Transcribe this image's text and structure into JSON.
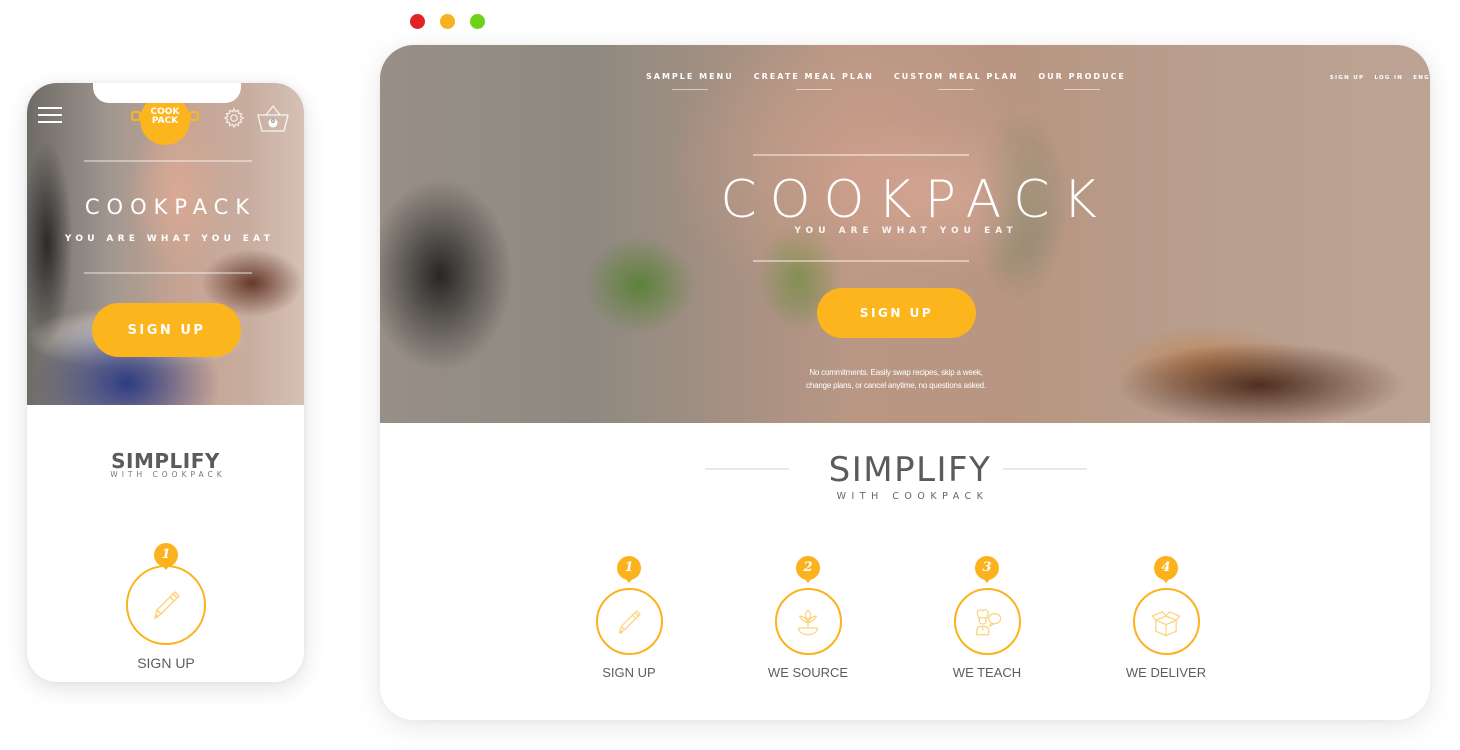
{
  "window": {
    "controls": [
      "close",
      "minimize",
      "maximize"
    ],
    "colors": {
      "close": "#e02424",
      "minimize": "#f7b21f",
      "maximize": "#6fd118"
    }
  },
  "brand": {
    "accent": "#fdb51e",
    "text_dark": "#5b5b5b"
  },
  "desktop": {
    "nav": {
      "items": [
        {
          "label": "SAMPLE MENU"
        },
        {
          "label": "CREATE MEAL PLAN"
        },
        {
          "label": "CUSTOM MEAL PLAN"
        },
        {
          "label": "OUR PRODUCE"
        }
      ]
    },
    "utility_nav": {
      "sign_up": "SIGN UP",
      "log_in": "LOG IN",
      "language": "ENG"
    },
    "hero": {
      "title": "COOKPACK",
      "tagline": "YOU ARE WHAT YOU EAT",
      "cta_label": "SIGN UP",
      "note_line1": "No commitments. Easily swap recipes, skip a week,",
      "note_line2": "change plans, or cancel anytime, no questions asked."
    },
    "simplify": {
      "title": "SIMPLIFY",
      "subtitle": "WITH COOKPACK"
    },
    "steps": [
      {
        "number": "1",
        "label": "SIGN UP",
        "icon": "pencil-icon"
      },
      {
        "number": "2",
        "label": "WE SOURCE",
        "icon": "sprout-icon"
      },
      {
        "number": "3",
        "label": "WE TEACH",
        "icon": "chef-chat-icon"
      },
      {
        "number": "4",
        "label": "WE DELIVER",
        "icon": "box-icon"
      }
    ]
  },
  "mobile": {
    "logo_line1": "COOK",
    "logo_line2": "PACK",
    "cart_count": "0",
    "hero": {
      "title": "COOKPACK",
      "tagline": "YOU ARE WHAT YOU EAT",
      "cta_label": "SIGN UP"
    },
    "simplify": {
      "title": "SIMPLIFY",
      "subtitle": "WITH COOKPACK"
    },
    "steps": [
      {
        "number": "1",
        "label": "SIGN UP",
        "icon": "pencil-icon"
      }
    ]
  }
}
